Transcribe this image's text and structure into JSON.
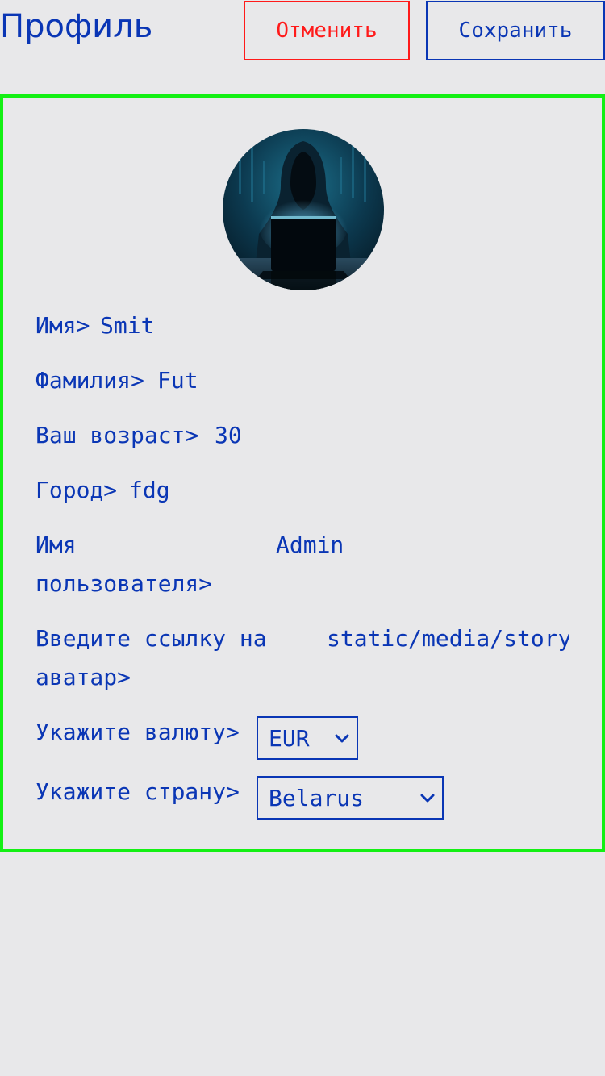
{
  "header": {
    "title": "Профиль",
    "cancel_label": "Отменить",
    "save_label": "Сохранить"
  },
  "profile": {
    "name_label": "Имя>",
    "name_value": "Smit",
    "surname_label": "Фамилия>",
    "surname_value": "Fut",
    "age_label": "Ваш возраст>",
    "age_value": "30",
    "city_label": "Город>",
    "city_value": "fdg",
    "username_label_line1": "Имя",
    "username_label_line2": "пользователя>",
    "username_value": "Admin",
    "avatar_link_label_line1": "Введите ссылку на",
    "avatar_link_label_line2": "аватар>",
    "avatar_link_value": "static/media/story",
    "currency_label": "Укажите валюту>",
    "currency_value": "EUR",
    "country_label": "Укажите страну>",
    "country_value": "Belarus"
  },
  "colors": {
    "background": "#e8e8ea",
    "text": "#0a36b5",
    "cancel": "#ff1a1a",
    "card_border": "#14f014"
  },
  "icons": {
    "avatar": "hooded-hacker-avatar",
    "select_chevron": "chevron-down-icon"
  }
}
